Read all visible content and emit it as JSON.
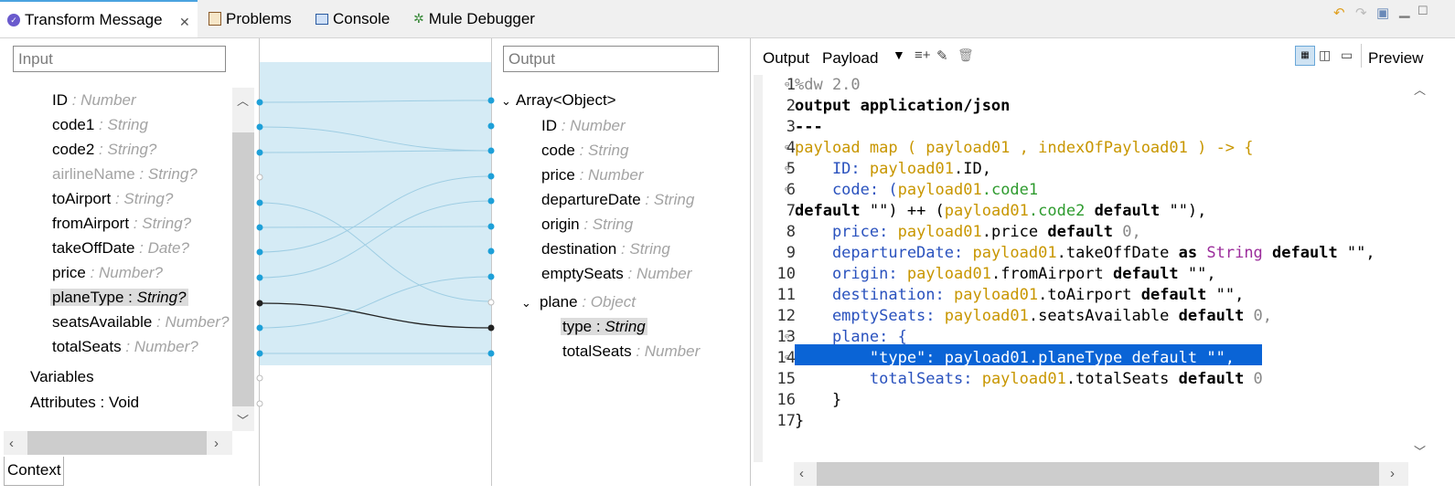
{
  "tabs": {
    "transform": "Transform Message",
    "problems": "Problems",
    "console": "Console",
    "debugger": "Mule Debugger"
  },
  "input": {
    "placeholder": "Input",
    "items": [
      {
        "name": "ID",
        "sep": " : ",
        "type": "Number"
      },
      {
        "name": "code1",
        "sep": " : ",
        "type": "String"
      },
      {
        "name": "code2",
        "sep": " : ",
        "type": "String?"
      },
      {
        "name": "airlineName",
        "sep": " : ",
        "type": "String?"
      },
      {
        "name": "toAirport",
        "sep": " : ",
        "type": "String?"
      },
      {
        "name": "fromAirport",
        "sep": " : ",
        "type": "String?"
      },
      {
        "name": "takeOffDate",
        "sep": " : ",
        "type": "Date?"
      },
      {
        "name": "price",
        "sep": " : ",
        "type": "Number?"
      },
      {
        "name": "planeType",
        "sep": " : ",
        "type": "String?"
      },
      {
        "name": "seatsAvailable",
        "sep": " : ",
        "type": "Number?"
      },
      {
        "name": "totalSeats",
        "sep": " : ",
        "type": "Number?"
      }
    ],
    "variables": "Variables",
    "attributes": "Attributes : Void",
    "context_tab": "Context"
  },
  "output": {
    "placeholder": "Output",
    "root": "Array<Object>",
    "items": [
      {
        "name": "ID",
        "sep": " : ",
        "type": "Number"
      },
      {
        "name": "code",
        "sep": " : ",
        "type": "String"
      },
      {
        "name": "price",
        "sep": " : ",
        "type": "Number"
      },
      {
        "name": "departureDate",
        "sep": " : ",
        "type": "String"
      },
      {
        "name": "origin",
        "sep": " : ",
        "type": "String"
      },
      {
        "name": "destination",
        "sep": " : ",
        "type": "String"
      },
      {
        "name": "emptySeats",
        "sep": " : ",
        "type": "Number"
      }
    ],
    "plane": {
      "name": "plane",
      "sep": " : ",
      "type": "Object"
    },
    "plane_items": [
      {
        "name": "type",
        "sep": " : ",
        "type": "String"
      },
      {
        "name": "totalSeats",
        "sep": " : ",
        "type": "Number"
      }
    ]
  },
  "editor": {
    "label_output": "Output",
    "label_payload": "Payload",
    "preview": "Preview",
    "line_numbers": [
      "1",
      "2",
      "3",
      "4",
      "5",
      "6",
      "7",
      "8",
      "9",
      "10",
      "11",
      "12",
      "13",
      "14",
      "15",
      "16",
      "17"
    ],
    "lines": {
      "l1": "%dw 2.0",
      "l2": "output application/json",
      "l3": "---",
      "l4a": "payload map ( payload01 , indexOfPayload01 ) -> {",
      "l5a": "    ID: ",
      "l5b": "payload01",
      "l5c": ".ID,",
      "l6a": "    code: (",
      "l6b": "payload01",
      "l6c": ".code1",
      "l7a": "default",
      "l7b": " \"\") ++ (",
      "l7c": "payload01",
      "l7d": ".code2 ",
      "l7e": "default",
      "l7f": " \"\"),",
      "l8a": "    price: ",
      "l8b": "payload01",
      "l8c": ".price ",
      "l8d": "default",
      "l8e": " 0,",
      "l9a": "    departureDate: ",
      "l9b": "payload01",
      "l9c": ".takeOffDate ",
      "l9d": "as",
      "l9e": " String ",
      "l9f": "default",
      "l9g": " \"\",",
      "l10a": "    origin: ",
      "l10b": "payload01",
      "l10c": ".fromAirport ",
      "l10d": "default",
      "l10e": " \"\",",
      "l11a": "    destination: ",
      "l11b": "payload01",
      "l11c": ".toAirport ",
      "l11d": "default",
      "l11e": " \"\",",
      "l12a": "    emptySeats: ",
      "l12b": "payload01",
      "l12c": ".seatsAvailable ",
      "l12d": "default",
      "l12e": " 0,",
      "l13": "    plane: {",
      "l14": "        \"type\": payload01.planeType default \"\",",
      "l15a": "        totalSeats: ",
      "l15b": "payload01",
      "l15c": ".totalSeats ",
      "l15d": "default",
      "l15e": " 0",
      "l16": "    }",
      "l17": "}"
    }
  }
}
